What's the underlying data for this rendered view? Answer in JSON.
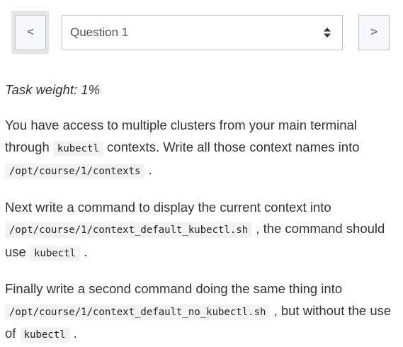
{
  "nav": {
    "prev_label": "<",
    "next_label": ">",
    "question_select": {
      "value": "Question 1"
    }
  },
  "task": {
    "weight": "Task weight: 1%",
    "p1": {
      "t1": "You have access to multiple clusters from your main terminal through ",
      "c1": "kubectl",
      "t2": " contexts. Write all those context names into ",
      "c2": "/opt/course/1/contexts",
      "t3": " ."
    },
    "p2": {
      "t1": "Next write a command to display the current context into ",
      "c1": "/opt/course/1/context_default_kubectl.sh",
      "t2": " , the command should use ",
      "c2": "kubectl",
      "t3": " ."
    },
    "p3": {
      "t1": "Finally write a second command doing the same thing into ",
      "c1": "/opt/course/1/context_default_no_kubectl.sh",
      "t2": " , but without the use of ",
      "c2": "kubectl",
      "t3": " ."
    }
  },
  "icons": {
    "select_arrow": "sort-icon"
  }
}
